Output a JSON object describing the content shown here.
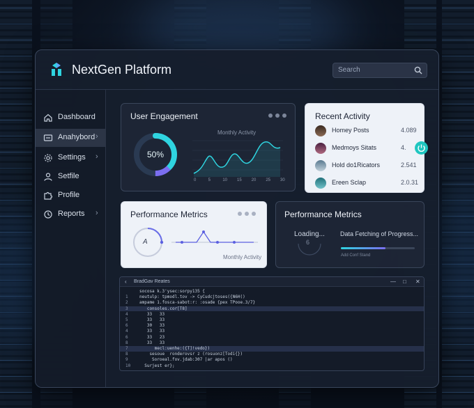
{
  "app": {
    "title": "NextGen Platform",
    "search_placeholder": "Search"
  },
  "sidebar": {
    "items": [
      {
        "label": "Dashboard",
        "icon": "home-icon",
        "chevron": false,
        "active": false
      },
      {
        "label": "Anahybord",
        "icon": "card-icon",
        "chevron": true,
        "active": true
      },
      {
        "label": "Settings",
        "icon": "gear-icon",
        "chevron": true,
        "active": false
      },
      {
        "label": "Setfile",
        "icon": "user-icon",
        "chevron": false,
        "active": false
      },
      {
        "label": "Profile",
        "icon": "puzzle-icon",
        "chevron": false,
        "active": false
      },
      {
        "label": "Reports",
        "icon": "clock-icon",
        "chevron": true,
        "active": false
      }
    ]
  },
  "engagement": {
    "title": "User Engagement",
    "percent_label": "50%",
    "percent_value": 50,
    "chart_title": "Monthly Activity",
    "x_ticks": [
      "0",
      "5",
      "10",
      "15",
      "20",
      "25",
      "30"
    ]
  },
  "recent_activity": {
    "title": "Recent Activity",
    "rows": [
      {
        "name": "Homey Posts",
        "value": "4.089"
      },
      {
        "name": "Medmoys Sitats",
        "value": "4."
      },
      {
        "name": "Hold do1Ricators",
        "value": "2.541"
      },
      {
        "name": "Ereen Sclap",
        "value": "2.0.31"
      }
    ]
  },
  "performance_left": {
    "title": "Performance Metrics",
    "ring_label": "A",
    "chart_caption": "Monthly Activity"
  },
  "performance_right": {
    "title": "Performance Metrics",
    "loading_label": "Loading...",
    "loading_sub": "6",
    "fetch_label": "Data Fetching of Progress...",
    "progress_value": 0.6,
    "progress_caption": "Add Conf Stand"
  },
  "terminal": {
    "title": "BradGav Reates",
    "lines": [
      {
        "n": "",
        "t": "socosa k.3'ysec:sorpy135 {"
      },
      {
        "n": "1",
        "t": "neutulp: tpmodl.tov -> CyCudcjtoses({N6H()"
      },
      {
        "n": "2",
        "t": "ampame 1.fosca-sabot:r: :osade {pex TPooe.3/7}"
      },
      {
        "n": "3",
        "t": "   consoles.cor[T8]",
        "hl": true
      },
      {
        "n": "4",
        "t": "   33   33"
      },
      {
        "n": "5",
        "t": "   33   33"
      },
      {
        "n": "6",
        "t": "   30   33"
      },
      {
        "n": "4",
        "t": "   33   33"
      },
      {
        "n": "6",
        "t": "   33   23"
      },
      {
        "n": "8",
        "t": "   33   33"
      },
      {
        "n": "7",
        "t": "      mecl:uenhe:({T]!vedo})",
        "hl": true
      },
      {
        "n": "8",
        "t": "    sesoue  ronderovsr z (rosuonz[Todi{})"
      },
      {
        "n": "9",
        "t": "     Soroeal.fov.jdab:307 |ar apos ()"
      },
      {
        "n": "10",
        "t": "  Surjest er};"
      }
    ],
    "controls": [
      "—",
      "□",
      "✕"
    ]
  },
  "colors": {
    "accent": "#2fd4e0",
    "purple": "#8a7cf0",
    "ring_blue": "#3f6de8"
  }
}
